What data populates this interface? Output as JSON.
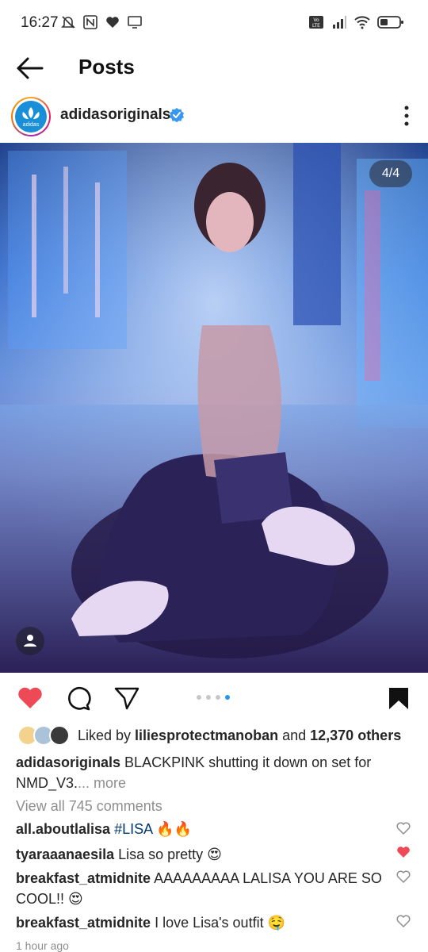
{
  "status_bar": {
    "time": "16:27",
    "left_icons": [
      "mute-alarm-icon",
      "nfc-icon",
      "heart-icon",
      "monitor-icon"
    ],
    "right_icons": [
      "volte-icon",
      "signal-icon",
      "wifi-icon",
      "battery-icon"
    ]
  },
  "header": {
    "title": "Posts"
  },
  "profile": {
    "username": "adidasoriginals",
    "avatar_text": "adidas",
    "verified": true
  },
  "post": {
    "counter": "4/4",
    "carousel_total": 4,
    "carousel_active_index": 3
  },
  "actions": {
    "liked": true,
    "saved": true
  },
  "likes": {
    "prefix": "Liked by ",
    "user": "liliesprotectmanoban",
    "middle": " and ",
    "count": "12,370 others"
  },
  "caption": {
    "username": "adidasoriginals",
    "text": " BLACKPINK shutting it down on set for NMD_V3.",
    "more": "... more"
  },
  "view_all": "View all 745 comments",
  "comments": [
    {
      "username": "all.aboutlalisa",
      "text": " ",
      "hashtag": "#LISA",
      "emoji": " 🔥🔥",
      "liked": false
    },
    {
      "username": "tyaraaanaesila",
      "text": " Lisa so pretty 😍",
      "liked": true
    },
    {
      "username": "breakfast_atmidnite",
      "text": " AAAAAAAAA LALISA YOU ARE SO COOL!! 😍",
      "liked": false
    },
    {
      "username": "breakfast_atmidnite",
      "text": " I love Lisa's outfit 🤤",
      "liked": false
    }
  ],
  "timestamp": "1 hour ago",
  "colors": {
    "heart_red": "#ed4956",
    "verified_blue": "#3897f0",
    "dot_active": "#2196f3",
    "hashtag": "#00376b",
    "muted_text": "#8e8e8e"
  }
}
